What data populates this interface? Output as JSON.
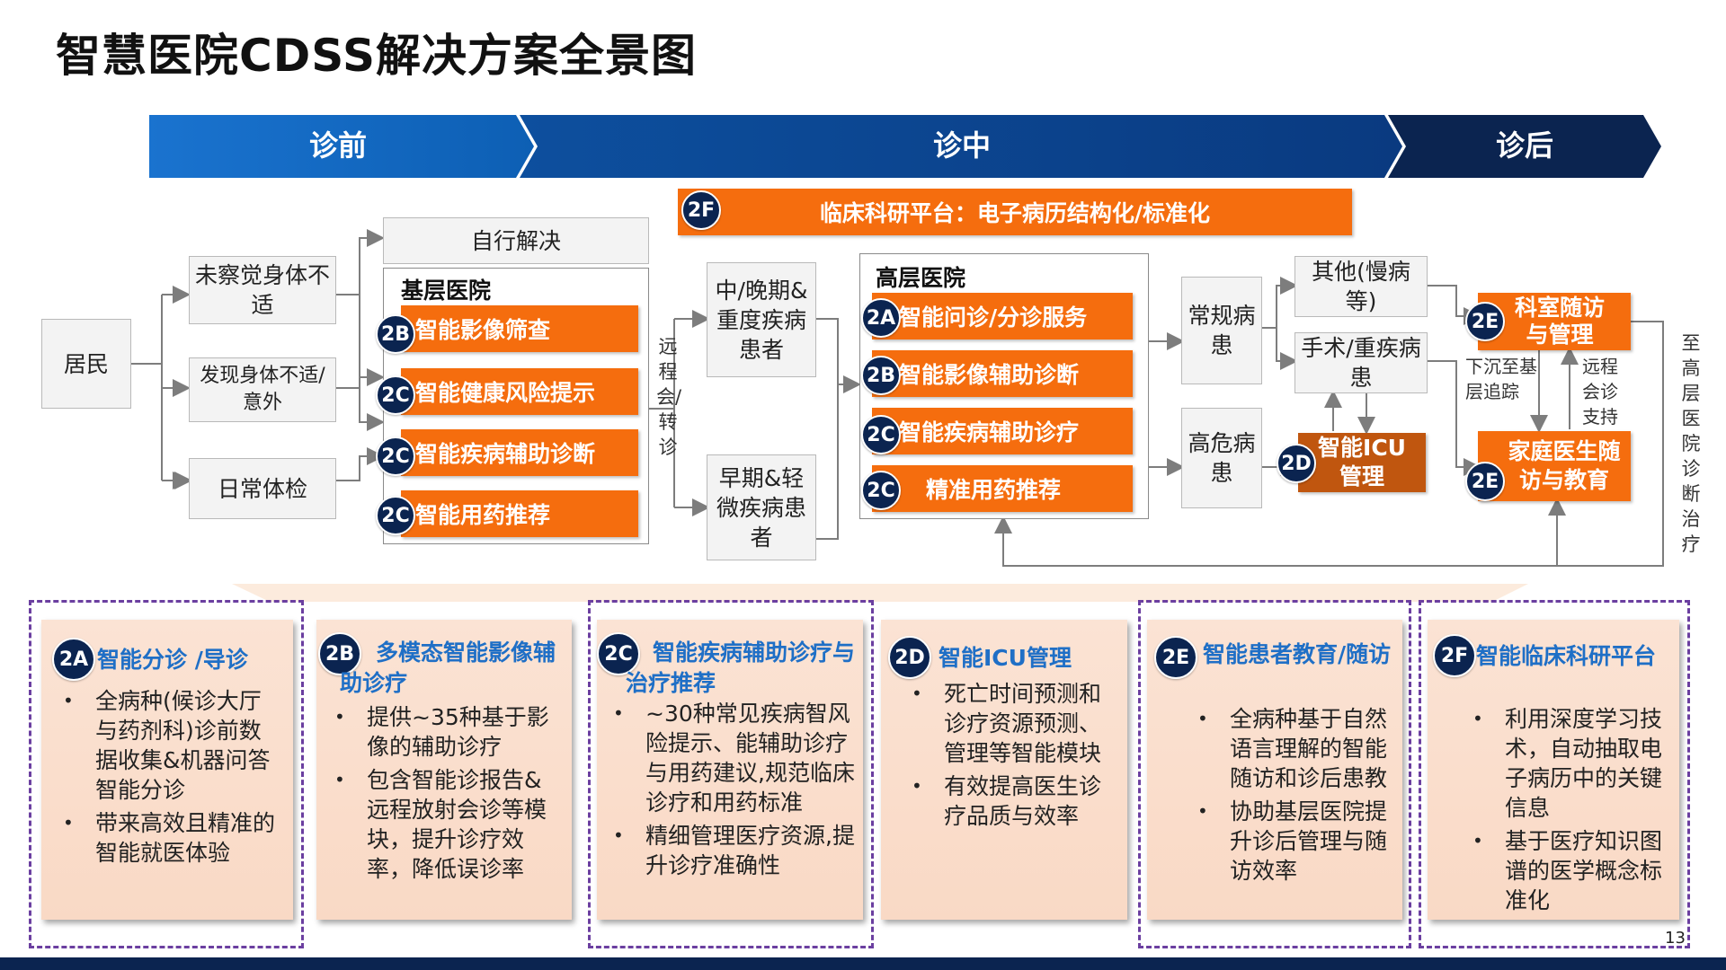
{
  "title": "智慧医院CDSS解决方案全景图",
  "phases": [
    "诊前",
    "诊中",
    "诊后"
  ],
  "research_bar": {
    "badge": "2F",
    "label": "临床科研平台：电子病历结构化/标准化"
  },
  "resident": "居民",
  "triggers": [
    "未察觉身体不适",
    "发现身体不适/ 意外",
    "日常体检"
  ],
  "self_resolve": "自行解决",
  "primary_hospital": {
    "title": "基层医院",
    "items": [
      {
        "badge": "2B",
        "label": "智能影像筛查"
      },
      {
        "badge": "2C",
        "label": "智能健康风险提示"
      },
      {
        "badge": "2C",
        "label": "智能疾病辅助诊断"
      },
      {
        "badge": "2C",
        "label": "智能用药推荐"
      }
    ]
  },
  "remote_consult": "远程会/转诊",
  "patient_groups": [
    "中/晚期&重度疾病患者",
    "早期&轻微疾病患者"
  ],
  "senior_hospital": {
    "title": "高层医院",
    "items": [
      {
        "badge": "2A",
        "label": "智能问诊/分诊服务"
      },
      {
        "badge": "2B",
        "label": "智能影像辅助诊断"
      },
      {
        "badge": "2C",
        "label": "智能疾病辅助诊疗"
      },
      {
        "badge": "2C",
        "label": "精准用药推荐"
      }
    ]
  },
  "patient_types": [
    "常规病患",
    "高危病患"
  ],
  "outcomes": [
    "其他(慢病等)",
    "手术/重疾病患"
  ],
  "icu": {
    "badge": "2D",
    "label": "智能ICU管理"
  },
  "followup_dept": {
    "badge": "2E",
    "label": "科室随访与管理"
  },
  "followup_family": {
    "badge": "2E",
    "label": "家庭医生随访与教育"
  },
  "down_label": "下沉至基层追踪",
  "remote_support": "远程会诊支持",
  "to_senior": "至高层医院诊断治疗",
  "cards": [
    {
      "badge": "2A",
      "title": "智能分诊 /导诊",
      "bullets": [
        "全病种(候诊大厅与药剂科)诊前数据收集&机器问答智能分诊",
        "带来高效且精准的智能就医体验"
      ]
    },
    {
      "badge": "2B",
      "title": "多模态智能影像辅助诊疗",
      "bullets": [
        "提供~35种基于影像的辅助诊疗",
        "包含智能诊报告&远程放射会诊等模块，提升诊疗效率，降低误诊率"
      ]
    },
    {
      "badge": "2C",
      "title": "智能疾病辅助诊疗与治疗推荐",
      "bullets": [
        "~30种常见疾病智风险提示、能辅助诊疗与用药建议,规范临床诊疗和用药标准",
        "精细管理医疗资源,提升诊疗准确性"
      ]
    },
    {
      "badge": "2D",
      "title": "智能ICU管理",
      "bullets": [
        "死亡时间预测和诊疗资源预测、管理等智能模块",
        "有效提高医生诊疗品质与效率"
      ]
    },
    {
      "badge": "2E",
      "title": "智能患者教育/随访",
      "bullets": [
        "全病种基于自然语言理解的智能随访和诊后患教",
        "协助基层医院提升诊后管理与随访效率"
      ]
    },
    {
      "badge": "2F",
      "title": "智能临床科研平台",
      "bullets": [
        "利用深度学习技术，自动抽取电子病历中的关键信息",
        "基于医疗知识图谱的医学概念标准化"
      ]
    }
  ],
  "page_number": "13",
  "colors": {
    "blue": "#0d6cc2",
    "navy": "#0b2450",
    "orange": "#f56d0e",
    "dark_orange": "#c0560f",
    "purple": "#6b3fa0"
  }
}
